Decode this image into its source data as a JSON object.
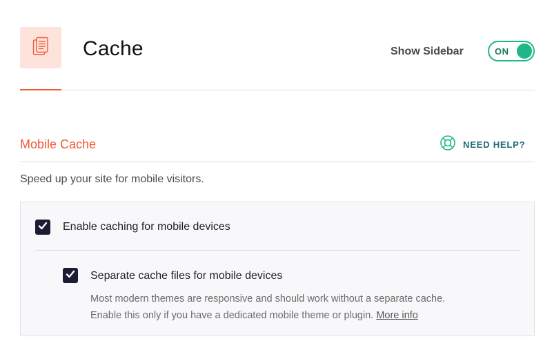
{
  "header": {
    "page_icon": "document-stack-icon",
    "title": "Cache",
    "sidebar_label": "Show Sidebar",
    "sidebar_toggle": {
      "state_label": "ON",
      "on": true
    }
  },
  "section": {
    "title": "Mobile Cache",
    "help_label": "NEED HELP?",
    "help_icon": "lifebuoy-icon",
    "description": "Speed up your site for mobile visitors."
  },
  "options": [
    {
      "label": "Enable caching for mobile devices",
      "checked": true
    },
    {
      "label": "Separate cache files for mobile devices",
      "checked": true,
      "help_line1": "Most modern themes are responsive and should work without a separate cache.",
      "help_line2": "Enable this only if you have a dedicated mobile theme or plugin.",
      "more_label": "More info"
    }
  ],
  "colors": {
    "accent": "#f05a36",
    "toggle_green": "#1fb78a",
    "help_teal": "#1d6b75",
    "checkbox": "#1b1b35"
  }
}
